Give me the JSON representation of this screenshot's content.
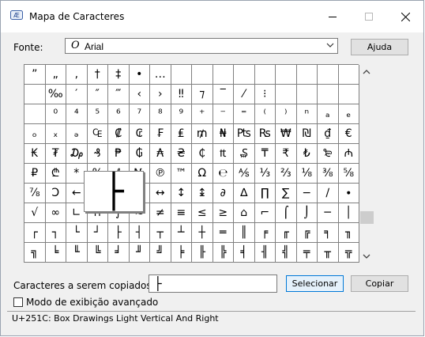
{
  "window": {
    "title": "Mapa de Caracteres"
  },
  "font": {
    "label": "Fonte:",
    "icon_glyph": "O",
    "value": "Arial"
  },
  "buttons": {
    "help": "Ajuda",
    "select": "Selecionar",
    "copy": "Copiar"
  },
  "grid": {
    "cells": [
      "”",
      "„",
      "‚",
      "†",
      "‡",
      "•",
      "…",
      "",
      "",
      "",
      "",
      "",
      "",
      "",
      "",
      "",
      "",
      "‰",
      "′",
      "″",
      "‴",
      "‹",
      "›",
      "‼",
      "⁊",
      "‾",
      "⁄",
      "⁝",
      "",
      "",
      "",
      "",
      "",
      "⁰",
      "⁴",
      "⁵",
      "⁶",
      "⁷",
      "⁸",
      "⁹",
      "⁺",
      "⁻",
      "⁼",
      "⁽",
      "⁾",
      "ⁿ",
      "ₐ",
      "ₑ",
      "ₒ",
      "ₓ",
      "ₔ",
      "₠",
      "₡",
      "₢",
      "₣",
      "₤",
      "₥",
      "₦",
      "₧",
      "₨",
      "₩",
      "₪",
      "₫",
      "€",
      "₭",
      "₮",
      "₯",
      "₰",
      "₱",
      "₲",
      "₳",
      "₴",
      "₵",
      "₶",
      "₷",
      "₸",
      "₹",
      "₺",
      "₻",
      "₼",
      "₽",
      "₾",
      "*",
      "%",
      "ℓ",
      "№",
      "℗",
      "™",
      "Ω",
      "℮",
      "⅍",
      "⅓",
      "⅔",
      "⅛",
      "⅜",
      "⅝",
      "⅞",
      "Ↄ",
      "←",
      "↑",
      "→",
      "↓",
      "↔",
      "↕",
      "↨",
      "∂",
      "∆",
      "∏",
      "∑",
      "−",
      "∕",
      "∙",
      "√",
      "∞",
      "∟",
      "∩",
      "∫",
      "≈",
      "≠",
      "≡",
      "≤",
      "≥",
      "⌂",
      "⌐",
      "⌠",
      "⌡",
      "─",
      "│",
      "┌",
      "┐",
      "└",
      "┘",
      "├",
      "┤",
      "┬",
      "┴",
      "┼",
      "═",
      "║",
      "╒",
      "╓",
      "╔",
      "╕",
      "╖",
      "╗",
      "╘",
      "╙",
      "╚",
      "╛",
      "╜",
      "╝",
      "╞",
      "╟",
      "╠",
      "╡",
      "╢",
      "╣",
      "╤",
      "╥",
      "╦",
      "╧",
      "╨",
      "╩",
      "╪",
      "╫",
      "╬",
      "▀",
      "▄",
      "█",
      "▌",
      "▐",
      "░",
      "▒",
      "▓",
      "■",
      "□",
      "▪",
      "▫",
      "▬",
      "▲",
      "►",
      "▼",
      "◄",
      "◊",
      "○",
      "◌",
      "●",
      "◘",
      "◙",
      "◦",
      "☺",
      "☻",
      "☼",
      "♀",
      "♂",
      "♠",
      "♣",
      "♥",
      "♦",
      "♪",
      "♫",
      "♯",
      "ﬁ",
      "ﬂ",
      "Ł",
      "Ƥ",
      "Ɍ"
    ],
    "zoomed_char": "├"
  },
  "copy": {
    "label": "Caracteres a serem copiados:",
    "value": "├"
  },
  "advanced": {
    "label": "Modo de exibição avançado"
  },
  "status": {
    "text": "U+251C: Box Drawings Light Vertical And Right"
  }
}
